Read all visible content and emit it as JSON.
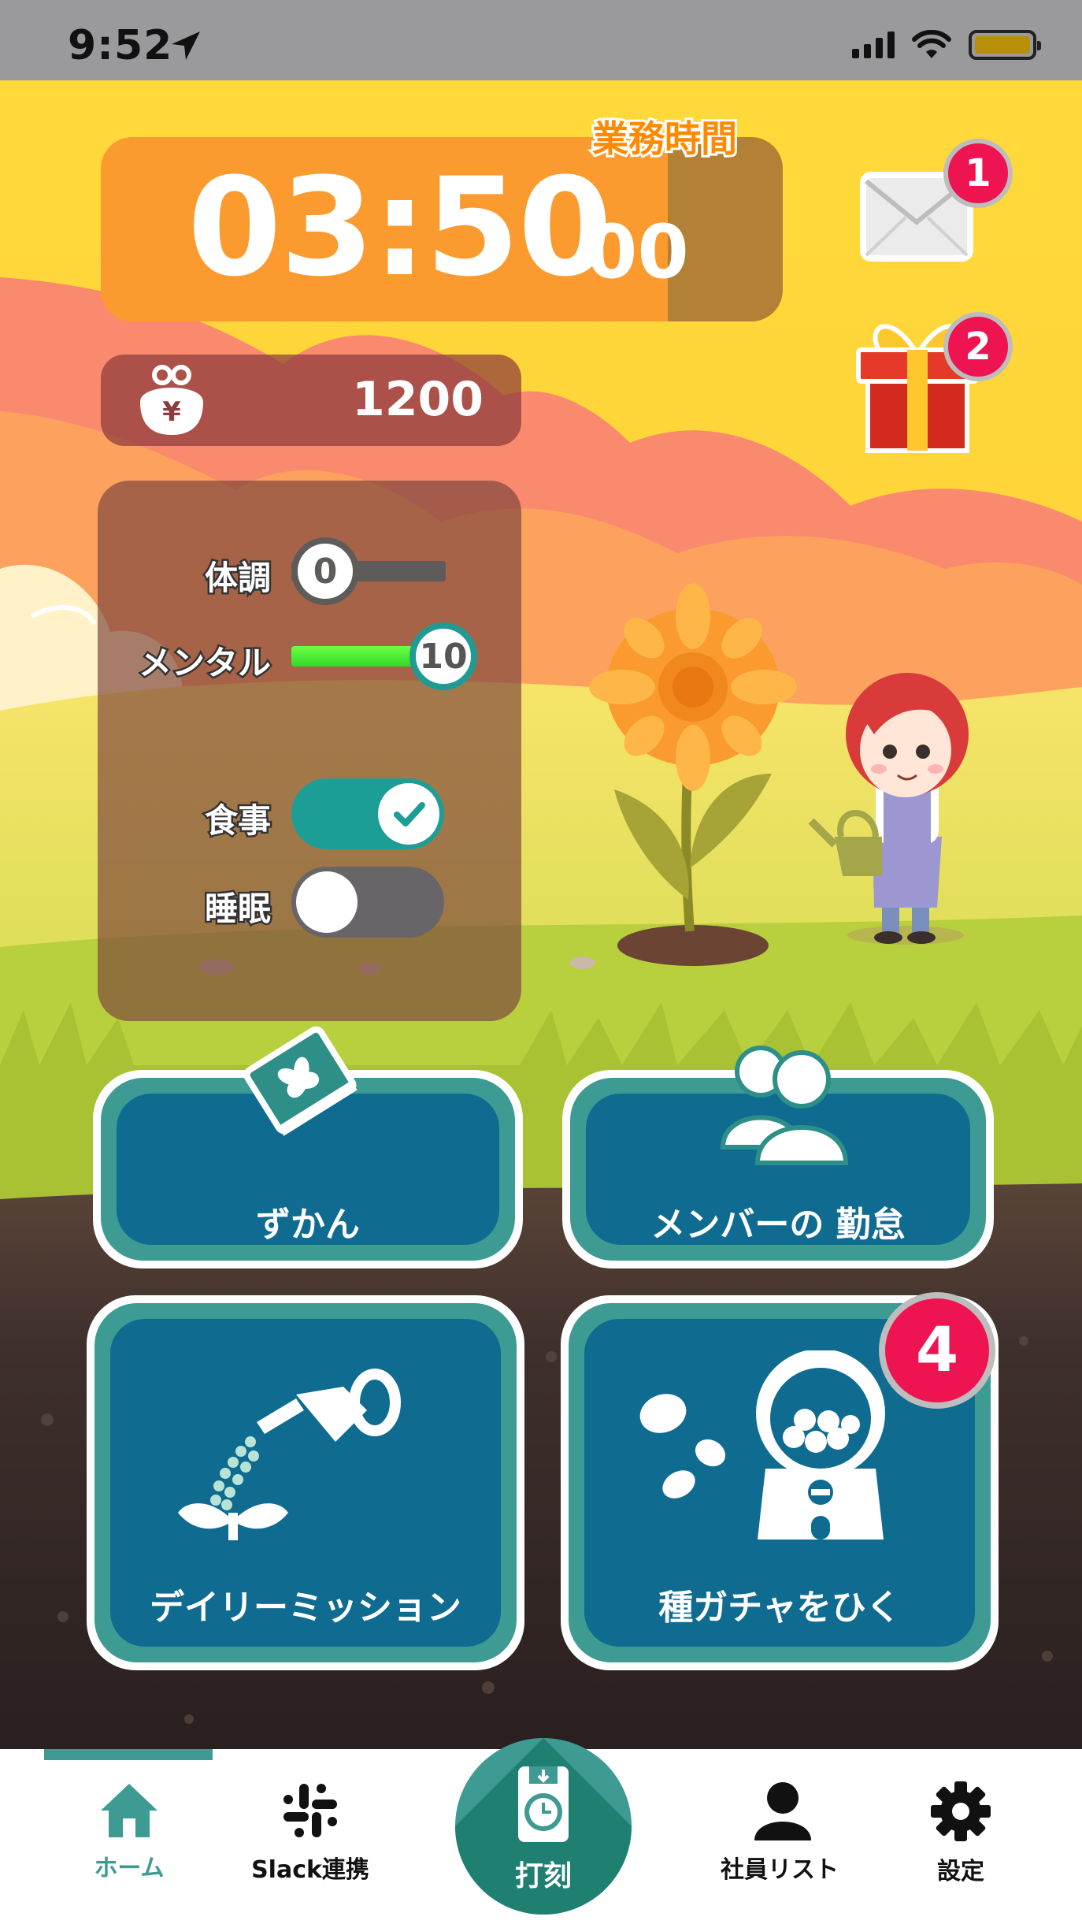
{
  "status_bar": {
    "time": "9:52"
  },
  "timer": {
    "hours_minutes": "03:50",
    "seconds": "00",
    "label": "業務時間"
  },
  "notifications": {
    "mail_count": "1",
    "gift_count": "2"
  },
  "wallet": {
    "currency_symbol": "¥",
    "amount": "1200"
  },
  "condition": {
    "physical": {
      "label": "体調",
      "value": "0",
      "fraction": 0
    },
    "mental": {
      "label": "メンタル",
      "value": "10",
      "fraction": 1.0
    },
    "meal": {
      "label": "食事",
      "checked": true
    },
    "sleep": {
      "label": "睡眠",
      "checked": false
    }
  },
  "menu": {
    "zukan": "ずかん",
    "member_attendance": "メンバーの 勤怠",
    "daily_mission": "デイリーミッション",
    "gacha": "種ガチャをひく",
    "gacha_badge": "4"
  },
  "nav": {
    "home": "ホーム",
    "slack": "Slack連携",
    "punch": "打刻",
    "employees": "社員リスト",
    "settings": "設定"
  },
  "colors": {
    "accent_teal": "#3d9b93",
    "button_blue": "#0f6b90",
    "timer_orange": "#fb9a2e",
    "badge_red": "#ee1452"
  }
}
